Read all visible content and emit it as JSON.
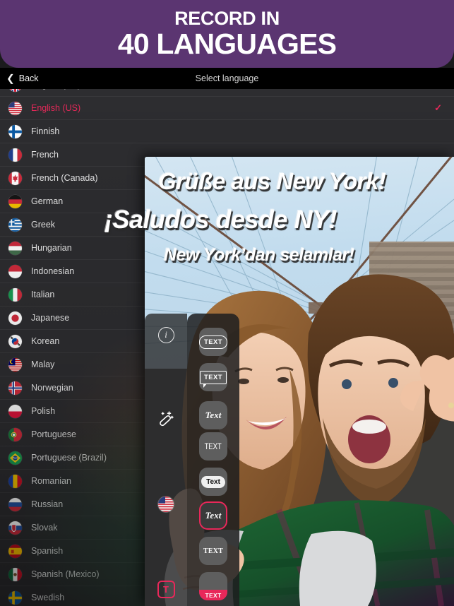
{
  "promo": {
    "line1": "RECORD IN",
    "line2": "40 LANGUAGES",
    "bg_color": "#5b3571"
  },
  "nav": {
    "back_label": "Back",
    "back_icon": "chevron-left-icon",
    "title": "Select language"
  },
  "accent_color": "#e8285a",
  "languages": [
    {
      "label": "English (UK)",
      "flag": "gb",
      "selected": false
    },
    {
      "label": "English (US)",
      "flag": "us",
      "selected": true,
      "check": "✓"
    },
    {
      "label": "Finnish",
      "flag": "fi",
      "selected": false
    },
    {
      "label": "French",
      "flag": "fr",
      "selected": false
    },
    {
      "label": "French (Canada)",
      "flag": "ca",
      "selected": false
    },
    {
      "label": "German",
      "flag": "de",
      "selected": false
    },
    {
      "label": "Greek",
      "flag": "gr",
      "selected": false
    },
    {
      "label": "Hungarian",
      "flag": "hu",
      "selected": false
    },
    {
      "label": "Indonesian",
      "flag": "id",
      "selected": false
    },
    {
      "label": "Italian",
      "flag": "it",
      "selected": false
    },
    {
      "label": "Japanese",
      "flag": "jp",
      "selected": false
    },
    {
      "label": "Korean",
      "flag": "kr",
      "selected": false
    },
    {
      "label": "Malay",
      "flag": "my",
      "selected": false
    },
    {
      "label": "Norwegian",
      "flag": "no",
      "selected": false
    },
    {
      "label": "Polish",
      "flag": "pl",
      "selected": false
    },
    {
      "label": "Portuguese",
      "flag": "pt",
      "selected": false
    },
    {
      "label": "Portuguese (Brazil)",
      "flag": "br",
      "selected": false
    },
    {
      "label": "Romanian",
      "flag": "ro",
      "selected": false
    },
    {
      "label": "Russian",
      "flag": "ru",
      "selected": false
    },
    {
      "label": "Slovak",
      "flag": "sk",
      "selected": false
    },
    {
      "label": "Spanish",
      "flag": "es",
      "selected": false
    },
    {
      "label": "Spanish (Mexico)",
      "flag": "mx",
      "selected": false
    },
    {
      "label": "Swedish",
      "flag": "se",
      "selected": false
    }
  ],
  "editor": {
    "overlay_texts": [
      "Grüße aus New York!",
      "¡Saludos desde NY!",
      "New York’dan selamlar!"
    ],
    "left_tools": [
      {
        "name": "info-icon",
        "glyph": "i"
      },
      {
        "name": "magic-wand-icon"
      },
      {
        "name": "language-flag-icon",
        "flag": "us"
      },
      {
        "name": "text-tool-button",
        "glyph": "T"
      }
    ],
    "text_styles": [
      {
        "name": "style-outline-rounded",
        "label": "TEXT",
        "selected": false
      },
      {
        "name": "style-speech-bubble",
        "label": "TEXT",
        "selected": false
      },
      {
        "name": "style-script-italic",
        "label": "Text",
        "selected": false
      },
      {
        "name": "style-condensed-caps",
        "label": "TEXT",
        "selected": false
      },
      {
        "name": "style-white-blob",
        "label": "Text",
        "selected": false
      },
      {
        "name": "style-script-selected",
        "label": "Text",
        "selected": true
      },
      {
        "name": "style-serif-caps",
        "label": "TEXT",
        "selected": false
      },
      {
        "name": "style-pink-band",
        "label": "TEXT",
        "selected": false
      }
    ]
  }
}
